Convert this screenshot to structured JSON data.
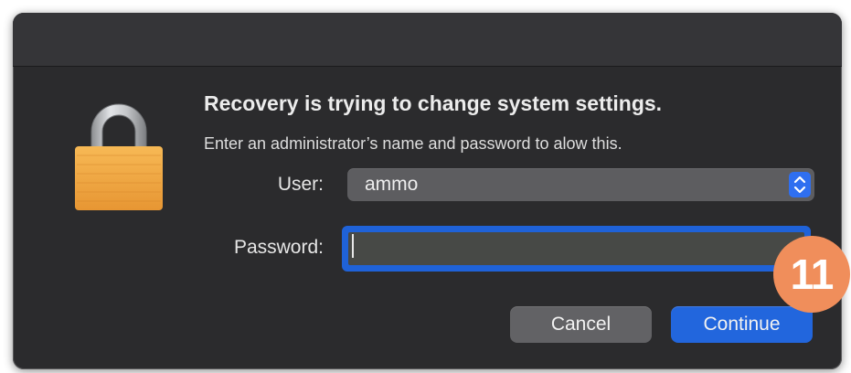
{
  "dialog": {
    "title": "Recovery is trying to change system settings.",
    "message": "Enter an administrator’s name and password to alow this.",
    "icon": "lock-icon"
  },
  "form": {
    "user_label": "User:",
    "user_value": "ammo",
    "password_label": "Password:",
    "password_value": ""
  },
  "buttons": {
    "cancel_label": "Cancel",
    "continue_label": "Continue"
  },
  "annotation": {
    "step_number": "11"
  },
  "colors": {
    "dialog_bg": "#2b2b2d",
    "accent": "#2266dd",
    "badge": "#f08e5b",
    "lock_body": "#f0a840"
  }
}
